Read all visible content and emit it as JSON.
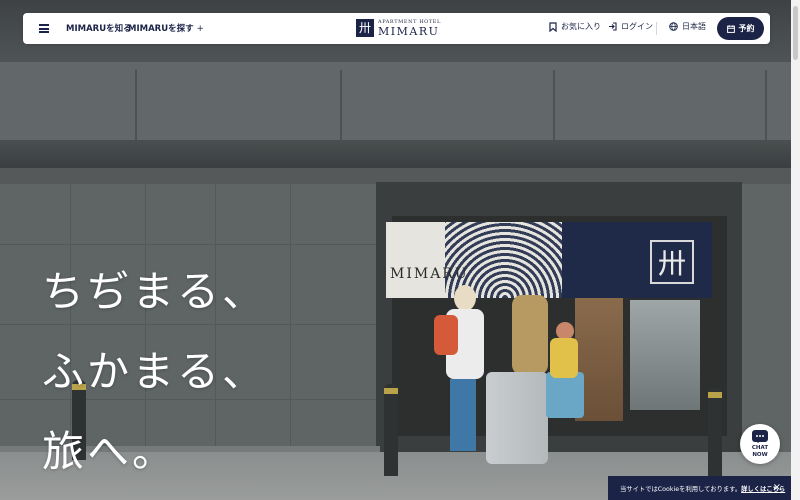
{
  "header": {
    "nav": [
      {
        "label": "MIMARUを知る"
      },
      {
        "label": "MIMARUを探す",
        "suffix": "+"
      }
    ],
    "logo": {
      "mark": "卅",
      "subtitle": "APARTMENT HOTEL",
      "name": "MIMARU"
    },
    "utility": {
      "favorites": "お気に入り",
      "login": "ログイン",
      "language": "日本語",
      "reserve": "予約"
    }
  },
  "hero": {
    "tagline": [
      "ちぢまる、",
      "ふかまる、",
      "旅へ。"
    ],
    "noren": {
      "brand": "MIMARU",
      "mark": "卅"
    }
  },
  "chat": {
    "line1": "CHAT",
    "line2": "NOW"
  },
  "cookie": {
    "message": "当サイトではCookieを利用しております。",
    "link": "詳しくはこちら",
    "close": "×"
  },
  "colors": {
    "brand_navy": "#1b2347",
    "header_bg": "#ffffff"
  },
  "icons": [
    "menu-icon",
    "bookmark-icon",
    "login-icon",
    "globe-icon",
    "calendar-icon",
    "chat-icon",
    "close-icon"
  ]
}
